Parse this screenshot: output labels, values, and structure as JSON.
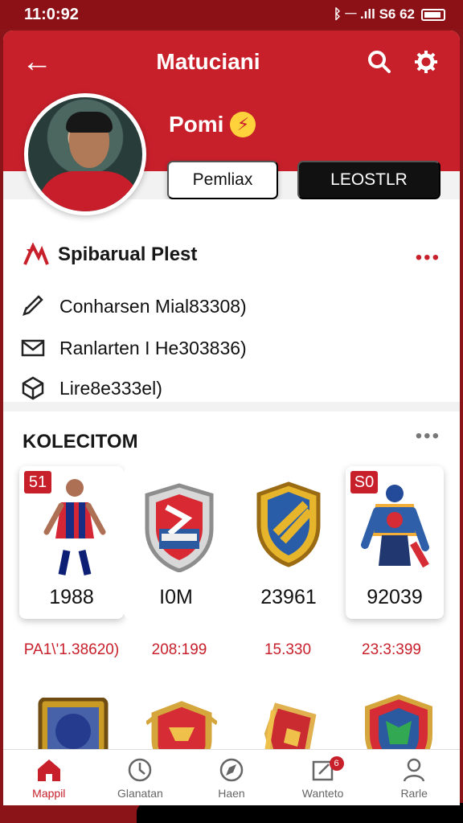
{
  "status": {
    "time": "11:0:92",
    "right": "ᛒ 𝄖 .ıll S6 62"
  },
  "header": {
    "title": "Matuciani",
    "back": "←",
    "search_icon": "search-icon",
    "settings_icon": "gear-icon"
  },
  "profile": {
    "name": "Pomi",
    "badge": "⚡",
    "button_primary": "Pemliax",
    "button_secondary": "LEOSTLR"
  },
  "info": {
    "title": "Spibarual Plest",
    "rows": [
      {
        "icon": "pencil-icon",
        "text": "Conharsen Mial83308)"
      },
      {
        "icon": "mail-icon",
        "text": "Ranlarten I He303836)"
      },
      {
        "icon": "cube-icon",
        "text": "Lire8e333el)"
      }
    ]
  },
  "collection": {
    "title": "KOLECITOM",
    "items": [
      {
        "rank": "51",
        "number": "1988",
        "price": "PA1\\'1.38620)"
      },
      {
        "rank": "",
        "number": "I0M",
        "price": "208:199"
      },
      {
        "rank": "",
        "number": "23961",
        "price": "15.330"
      },
      {
        "rank": "S0",
        "number": "92039",
        "price": "23:3:399"
      }
    ]
  },
  "nav": [
    {
      "label": "Mappil",
      "icon": "home-icon"
    },
    {
      "label": "Glanatan",
      "icon": "clock-icon"
    },
    {
      "label": "Haen",
      "icon": "compass-icon"
    },
    {
      "label": "Wanteto",
      "icon": "edit-icon",
      "badge": "6"
    },
    {
      "label": "Rarle",
      "icon": "person-icon"
    }
  ]
}
